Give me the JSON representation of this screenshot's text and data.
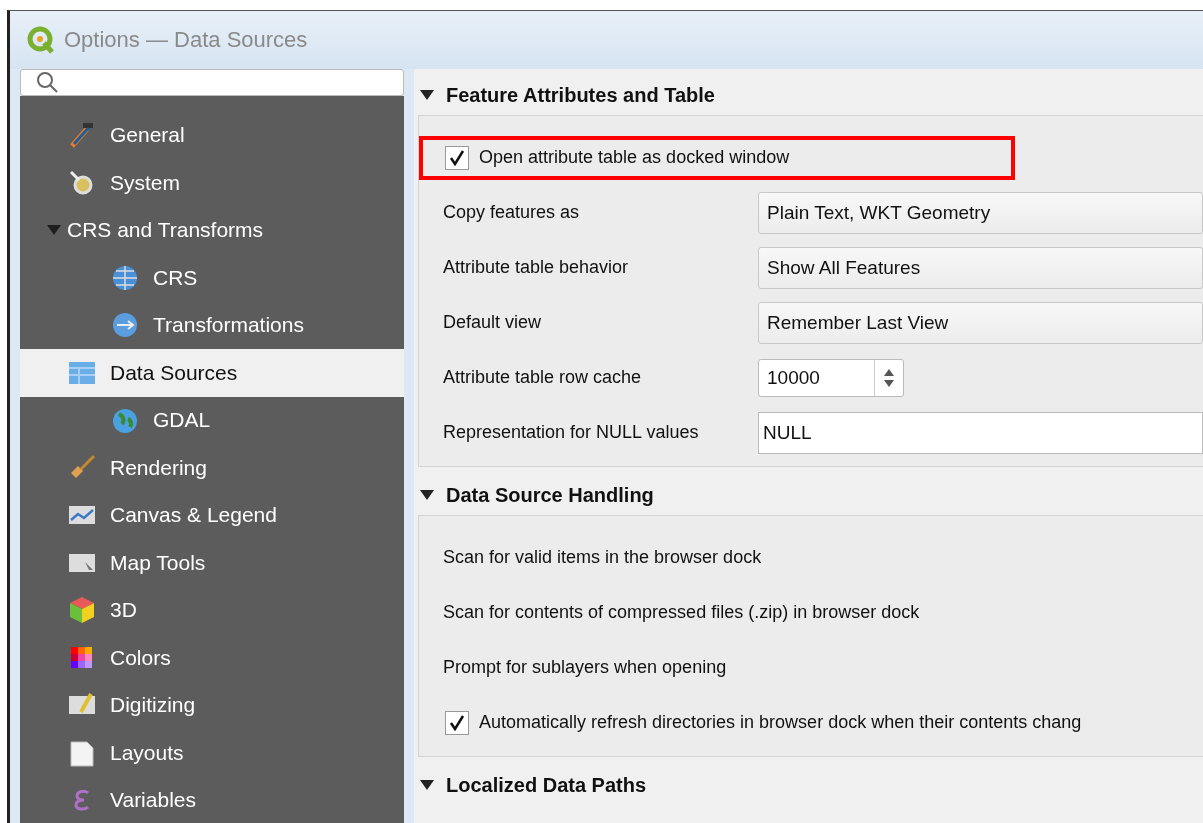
{
  "window": {
    "title": "Options — Data Sources"
  },
  "sidebar": {
    "items": [
      {
        "label": "General",
        "selected": false
      },
      {
        "label": "System",
        "selected": false
      },
      {
        "label": "CRS and Transforms",
        "selected": false,
        "expanded": true,
        "children": [
          {
            "label": "CRS",
            "selected": false
          },
          {
            "label": "Transformations",
            "selected": false
          }
        ]
      },
      {
        "label": "Data Sources",
        "selected": true,
        "children": [
          {
            "label": "GDAL",
            "selected": false
          }
        ]
      },
      {
        "label": "Rendering",
        "selected": false
      },
      {
        "label": "Canvas & Legend",
        "selected": false
      },
      {
        "label": "Map Tools",
        "selected": false
      },
      {
        "label": "3D",
        "selected": false
      },
      {
        "label": "Colors",
        "selected": false
      },
      {
        "label": "Digitizing",
        "selected": false
      },
      {
        "label": "Layouts",
        "selected": false
      },
      {
        "label": "Variables",
        "selected": false
      }
    ]
  },
  "sections": [
    {
      "title": "Feature Attributes and Table",
      "expanded": true,
      "rows": [
        {
          "kind": "checkbox",
          "label": "Open attribute table as docked window",
          "checked": true,
          "highlighted": true
        },
        {
          "kind": "combo",
          "label": "Copy features as",
          "value": "Plain Text, WKT Geometry"
        },
        {
          "kind": "combo",
          "label": "Attribute table behavior",
          "value": "Show All Features"
        },
        {
          "kind": "combo",
          "label": "Default view",
          "value": "Remember Last View"
        },
        {
          "kind": "spin",
          "label": "Attribute table row cache",
          "value": "10000"
        },
        {
          "kind": "text",
          "label": "Representation for NULL values",
          "value": "NULL"
        }
      ]
    },
    {
      "title": "Data Source Handling",
      "expanded": true,
      "rows": [
        {
          "kind": "label",
          "label": "Scan for valid items in the browser dock"
        },
        {
          "kind": "label",
          "label": "Scan for contents of compressed files (.zip) in browser dock"
        },
        {
          "kind": "label",
          "label": "Prompt for sublayers when opening"
        },
        {
          "kind": "checkbox",
          "label": "Automatically refresh directories in browser dock when their contents chang",
          "checked": true,
          "highlighted": false
        }
      ]
    },
    {
      "title": "Localized Data Paths",
      "expanded": true
    }
  ]
}
